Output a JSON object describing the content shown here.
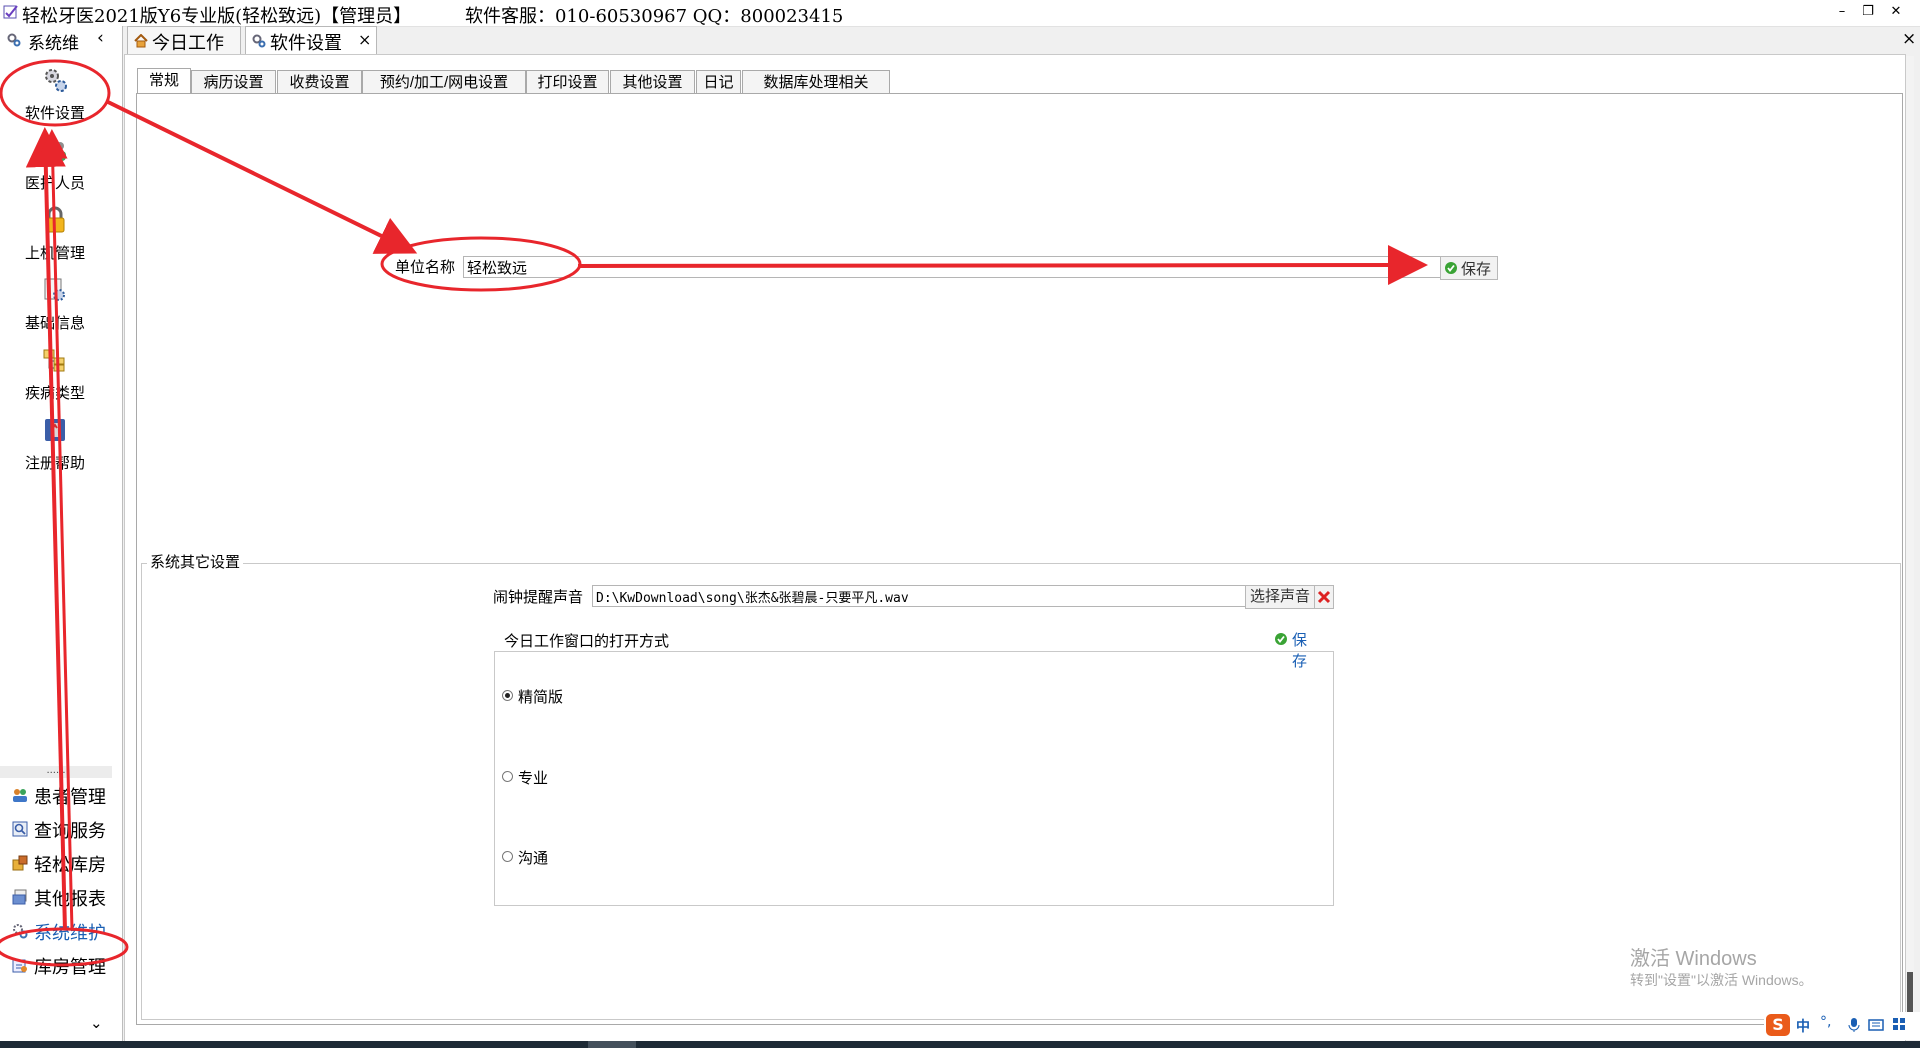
{
  "window": {
    "title": "轻松牙医2021版Y6专业版(轻松致远)【管理员】",
    "service": "软件客服：010-60530967 QQ：800023415",
    "min_icon": "minimize-icon",
    "restore_icon": "restore-icon",
    "close_icon": "close-icon"
  },
  "sidebar": {
    "header_label": "系统维",
    "collapse_glyph": "‹",
    "tools": [
      {
        "label": "软件设置",
        "icon": "gears-icon"
      },
      {
        "label": "医护人员",
        "icon": "staff-icon"
      },
      {
        "label": "上机管理",
        "icon": "lock-icon"
      },
      {
        "label": "基础信息",
        "icon": "info-icon"
      },
      {
        "label": "疾病类型",
        "icon": "disease-icon"
      },
      {
        "label": "注册帮助",
        "icon": "help-icon"
      }
    ],
    "dots": "......",
    "nav": [
      {
        "label": "患者管理",
        "icon": "patients-icon"
      },
      {
        "label": "查询服务",
        "icon": "search-icon"
      },
      {
        "label": "轻松库房",
        "icon": "warehouse-icon"
      },
      {
        "label": "其他报表",
        "icon": "report-icon"
      },
      {
        "label": "系统维护",
        "icon": "system-icon"
      },
      {
        "label": "库房管理",
        "icon": "stock-icon"
      }
    ],
    "expand_glyph": "⌄"
  },
  "doc_tabs": [
    {
      "label": "今日工作",
      "icon": "home-icon"
    },
    {
      "label": "软件设置",
      "icon": "gears-icon",
      "close": "×"
    }
  ],
  "panel_close": "×",
  "settings_tabs": [
    "常规",
    "病历设置",
    "收费设置",
    "预约/加工/网电设置",
    "打印设置",
    "其他设置",
    "日记",
    "数据库处理相关"
  ],
  "general": {
    "unit_name_label": "单位名称",
    "unit_name_value": "轻松致远",
    "save_label": "保存"
  },
  "other_settings": {
    "legend": "系统其它设置",
    "alarm_label": "闹钟提醒声音",
    "alarm_value": "D:\\KwDownload\\song\\张杰&张碧晨-只要平凡.wav",
    "choose_sound": "选择声音",
    "open_mode_legend": "今日工作窗口的打开方式",
    "open_mode_save": "保存",
    "options": [
      "精简版",
      "专业",
      "沟通"
    ],
    "selected": "精简版"
  },
  "watermark": {
    "line1": "激活 Windows",
    "line2": "转到\"设置\"以激活 Windows。"
  },
  "tray": {
    "ime": "中",
    "punct": "°,"
  },
  "colors": {
    "annotation": "#e8262c",
    "active_nav": "#1a5fb4",
    "save_check": "#3aa335"
  }
}
